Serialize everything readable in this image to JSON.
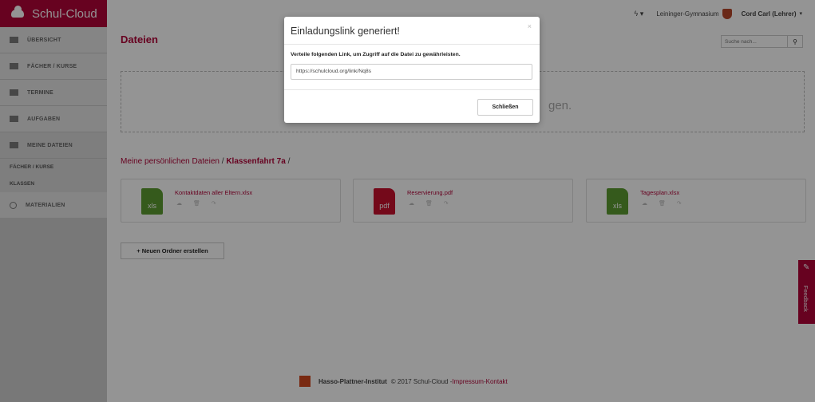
{
  "brand": {
    "name": "Schul-Cloud",
    "icon": "cloud-icon"
  },
  "sidebar": {
    "items": [
      {
        "label": "ÜBERSICHT",
        "icon": "dashboard-icon"
      },
      {
        "label": "FÄCHER / KURSE",
        "icon": "graduation-cap-icon"
      },
      {
        "label": "TERMINE",
        "icon": "calendar-icon"
      },
      {
        "label": "AUFGABEN",
        "icon": "tasks-icon"
      },
      {
        "label": "MEINE DATEIEN",
        "icon": "folder-icon"
      }
    ],
    "sub_items": [
      {
        "label": "FÄCHER / KURSE"
      },
      {
        "label": "KLASSEN"
      }
    ],
    "materials": {
      "label": "MATERIALIEN",
      "icon": "search-icon"
    }
  },
  "topbar": {
    "bolt": "ϟ ▾",
    "school": "Leininger-Gymnasium",
    "user": "Cord Carl (Lehrer)",
    "caret": "▾"
  },
  "main": {
    "title": "Dateien",
    "search_placeholder": "Suche nach...",
    "dropzone_text": "gen.",
    "breadcrumb": {
      "root": "Meine persönlichen Dateien",
      "sep1": " / ",
      "current": "Klassenfahrt 7a",
      "sep2": " /"
    },
    "files": [
      {
        "name": "Kontaktdaten aller Eltern.xlsx",
        "type": "xls",
        "color": "#5c9c31"
      },
      {
        "name": "Reservierung.pdf",
        "type": "pdf",
        "color": "#c8102e"
      },
      {
        "name": "Tagesplan.xlsx",
        "type": "xls",
        "color": "#5c9c31"
      }
    ],
    "file_actions": "☁ 🗑 ↷",
    "new_folder_label": "+ Neuen Ordner erstellen"
  },
  "footer": {
    "org": "Hasso-Plattner-Institut",
    "copyright": "© 2017 Schul-Cloud - ",
    "impressum": "Impressum",
    "dash": " - ",
    "kontakt": "Kontakt"
  },
  "feedback": {
    "label": "Feedback"
  },
  "modal": {
    "title": "Einladungslink generiert!",
    "close": "×",
    "label": "Verteile folgenden Link, um Zugriff auf die Datei zu gewährleisten.",
    "link_value": "https://schulcloud.org/link/Nq8s",
    "button": "Schließen"
  },
  "colors": {
    "accent": "#b10438",
    "xls": "#5c9c31",
    "pdf": "#c8102e"
  }
}
